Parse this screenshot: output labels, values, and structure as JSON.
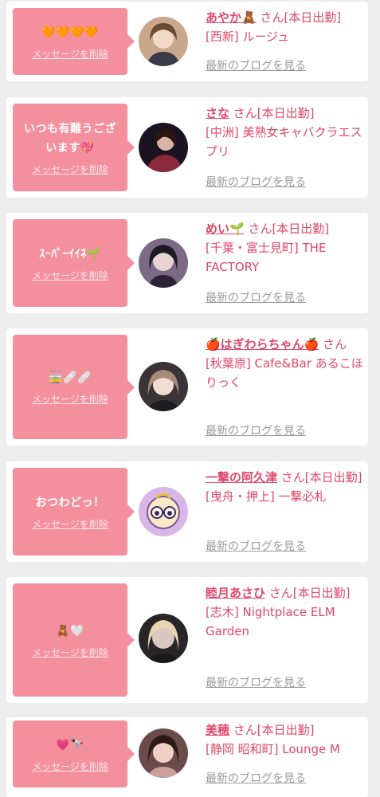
{
  "entries": [
    {
      "message": "🧡🧡🧡🧡",
      "delete_label": "メッセージを削除",
      "name": "あやか🧸",
      "san_status": " さん[本日出勤]",
      "shop": "[西新] ルージュ",
      "blog_label": "最新のブログを見る"
    },
    {
      "message": "いつも有難うございます💖",
      "delete_label": "メッセージを削除",
      "name": "さな",
      "san_status": " さん[本日出勤]",
      "shop": "[中洲] 美熟女キャバクラエスプリ",
      "blog_label": "最新のブログを見る"
    },
    {
      "message": "ｽｰﾊﾟｰｲｲﾈ🌱",
      "delete_label": "メッセージを削除",
      "name": "めい🌱",
      "san_status": " さん[本日出勤]",
      "shop": "[千葉・富士見町] THE FACTORY",
      "blog_label": "最新のブログを見る"
    },
    {
      "message": "🚋🩹🩹",
      "delete_label": "メッセージを削除",
      "name": "🍎はぎわらちゃん🍎",
      "san_status": " さん",
      "shop": "[秋葉原] Cafe&Bar あるこほりっく",
      "blog_label": "最新のブログを見る"
    },
    {
      "message": "おつわどっ！",
      "delete_label": "メッセージを削除",
      "name": "一撃の阿久津",
      "san_status": " さん[本日出勤]",
      "shop": "[曳舟・押上] 一撃必札",
      "blog_label": "最新のブログを見る"
    },
    {
      "message": "🧸🤍",
      "delete_label": "メッセージを削除",
      "name": "睦月あさひ",
      "san_status": " さん[本日出勤]",
      "shop": "[志木] Nightplace ELM Garden",
      "blog_label": "最新のブログを見る"
    },
    {
      "message": "💗🔭",
      "delete_label": "メッセージを削除",
      "name": "美穂",
      "san_status": " さん[本日出勤]",
      "shop": "[静岡 昭和町] Lounge M",
      "blog_label": "最新のブログを見る"
    }
  ],
  "colors": {
    "bubble": "#f4909e",
    "name": "#e0476a",
    "background": "#ededed"
  }
}
